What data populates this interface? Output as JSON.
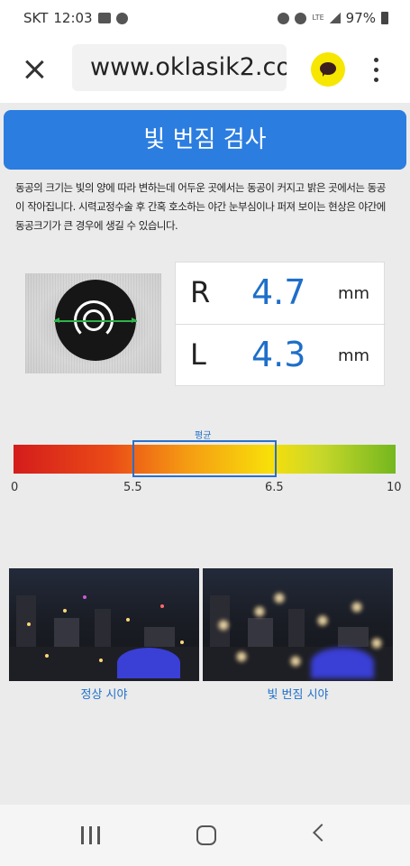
{
  "status_bar": {
    "carrier": "SKT",
    "time": "12:03",
    "network": "LTE",
    "battery": "97%"
  },
  "browser": {
    "url": "www.oklasik2.co",
    "icons": [
      "close-icon",
      "kakaotalk-icon",
      "more-vert-icon"
    ]
  },
  "page": {
    "title": "빛 번짐 검사",
    "description": "동공의 크기는 빛의 양에 따라 변하는데 어두운 곳에서는 동공이 커지고 밝은 곳에서는 동공이 작아집니다. 시력교정수술 후 간혹 호소하는 야간 눈부심이나 퍼져 보이는 현상은 야간에 동공크기가 큰 경우에 생길 수 있습니다.",
    "measurements": [
      {
        "side": "R",
        "value": "4.7",
        "unit": "mm"
      },
      {
        "side": "L",
        "value": "4.3",
        "unit": "mm"
      }
    ],
    "scale": {
      "average_label": "평균",
      "ticks": [
        "0",
        "5.5",
        "6.5",
        "10"
      ],
      "min": 0,
      "max": 10,
      "average_range": [
        5.5,
        6.5
      ]
    },
    "images": [
      {
        "caption": "정상 시야"
      },
      {
        "caption": "빛 번짐 시야"
      }
    ]
  },
  "colors": {
    "accent": "#2b7de0",
    "value_text": "#1e6fc9"
  }
}
